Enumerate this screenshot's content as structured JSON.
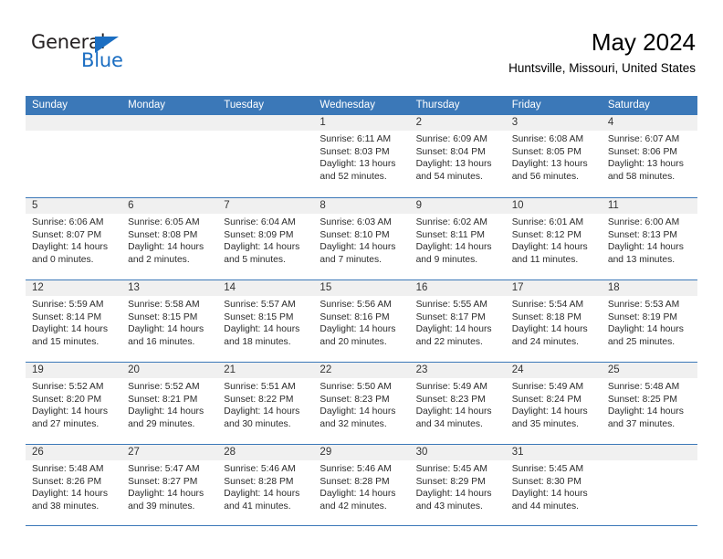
{
  "logo": {
    "word1": "General",
    "word2": "Blue",
    "triangle_color": "#1b6ec2"
  },
  "header": {
    "title": "May 2024",
    "subtitle": "Huntsville, Missouri, United States"
  },
  "theme": {
    "header_blue": "#3b78b8",
    "day_band_gray": "#f0f0f0",
    "text_color": "#2b2b2b"
  },
  "weekdays": [
    "Sunday",
    "Monday",
    "Tuesday",
    "Wednesday",
    "Thursday",
    "Friday",
    "Saturday"
  ],
  "labels": {
    "sunrise": "Sunrise:",
    "sunset": "Sunset:",
    "daylight": "Daylight:"
  },
  "weeks": [
    [
      {
        "day": "",
        "empty": true
      },
      {
        "day": "",
        "empty": true
      },
      {
        "day": "",
        "empty": true
      },
      {
        "day": "1",
        "sunrise": "Sunrise: 6:11 AM",
        "sunset": "Sunset: 8:03 PM",
        "daylight": "Daylight: 13 hours and 52 minutes."
      },
      {
        "day": "2",
        "sunrise": "Sunrise: 6:09 AM",
        "sunset": "Sunset: 8:04 PM",
        "daylight": "Daylight: 13 hours and 54 minutes."
      },
      {
        "day": "3",
        "sunrise": "Sunrise: 6:08 AM",
        "sunset": "Sunset: 8:05 PM",
        "daylight": "Daylight: 13 hours and 56 minutes."
      },
      {
        "day": "4",
        "sunrise": "Sunrise: 6:07 AM",
        "sunset": "Sunset: 8:06 PM",
        "daylight": "Daylight: 13 hours and 58 minutes."
      }
    ],
    [
      {
        "day": "5",
        "sunrise": "Sunrise: 6:06 AM",
        "sunset": "Sunset: 8:07 PM",
        "daylight": "Daylight: 14 hours and 0 minutes."
      },
      {
        "day": "6",
        "sunrise": "Sunrise: 6:05 AM",
        "sunset": "Sunset: 8:08 PM",
        "daylight": "Daylight: 14 hours and 2 minutes."
      },
      {
        "day": "7",
        "sunrise": "Sunrise: 6:04 AM",
        "sunset": "Sunset: 8:09 PM",
        "daylight": "Daylight: 14 hours and 5 minutes."
      },
      {
        "day": "8",
        "sunrise": "Sunrise: 6:03 AM",
        "sunset": "Sunset: 8:10 PM",
        "daylight": "Daylight: 14 hours and 7 minutes."
      },
      {
        "day": "9",
        "sunrise": "Sunrise: 6:02 AM",
        "sunset": "Sunset: 8:11 PM",
        "daylight": "Daylight: 14 hours and 9 minutes."
      },
      {
        "day": "10",
        "sunrise": "Sunrise: 6:01 AM",
        "sunset": "Sunset: 8:12 PM",
        "daylight": "Daylight: 14 hours and 11 minutes."
      },
      {
        "day": "11",
        "sunrise": "Sunrise: 6:00 AM",
        "sunset": "Sunset: 8:13 PM",
        "daylight": "Daylight: 14 hours and 13 minutes."
      }
    ],
    [
      {
        "day": "12",
        "sunrise": "Sunrise: 5:59 AM",
        "sunset": "Sunset: 8:14 PM",
        "daylight": "Daylight: 14 hours and 15 minutes."
      },
      {
        "day": "13",
        "sunrise": "Sunrise: 5:58 AM",
        "sunset": "Sunset: 8:15 PM",
        "daylight": "Daylight: 14 hours and 16 minutes."
      },
      {
        "day": "14",
        "sunrise": "Sunrise: 5:57 AM",
        "sunset": "Sunset: 8:15 PM",
        "daylight": "Daylight: 14 hours and 18 minutes."
      },
      {
        "day": "15",
        "sunrise": "Sunrise: 5:56 AM",
        "sunset": "Sunset: 8:16 PM",
        "daylight": "Daylight: 14 hours and 20 minutes."
      },
      {
        "day": "16",
        "sunrise": "Sunrise: 5:55 AM",
        "sunset": "Sunset: 8:17 PM",
        "daylight": "Daylight: 14 hours and 22 minutes."
      },
      {
        "day": "17",
        "sunrise": "Sunrise: 5:54 AM",
        "sunset": "Sunset: 8:18 PM",
        "daylight": "Daylight: 14 hours and 24 minutes."
      },
      {
        "day": "18",
        "sunrise": "Sunrise: 5:53 AM",
        "sunset": "Sunset: 8:19 PM",
        "daylight": "Daylight: 14 hours and 25 minutes."
      }
    ],
    [
      {
        "day": "19",
        "sunrise": "Sunrise: 5:52 AM",
        "sunset": "Sunset: 8:20 PM",
        "daylight": "Daylight: 14 hours and 27 minutes."
      },
      {
        "day": "20",
        "sunrise": "Sunrise: 5:52 AM",
        "sunset": "Sunset: 8:21 PM",
        "daylight": "Daylight: 14 hours and 29 minutes."
      },
      {
        "day": "21",
        "sunrise": "Sunrise: 5:51 AM",
        "sunset": "Sunset: 8:22 PM",
        "daylight": "Daylight: 14 hours and 30 minutes."
      },
      {
        "day": "22",
        "sunrise": "Sunrise: 5:50 AM",
        "sunset": "Sunset: 8:23 PM",
        "daylight": "Daylight: 14 hours and 32 minutes."
      },
      {
        "day": "23",
        "sunrise": "Sunrise: 5:49 AM",
        "sunset": "Sunset: 8:23 PM",
        "daylight": "Daylight: 14 hours and 34 minutes."
      },
      {
        "day": "24",
        "sunrise": "Sunrise: 5:49 AM",
        "sunset": "Sunset: 8:24 PM",
        "daylight": "Daylight: 14 hours and 35 minutes."
      },
      {
        "day": "25",
        "sunrise": "Sunrise: 5:48 AM",
        "sunset": "Sunset: 8:25 PM",
        "daylight": "Daylight: 14 hours and 37 minutes."
      }
    ],
    [
      {
        "day": "26",
        "sunrise": "Sunrise: 5:48 AM",
        "sunset": "Sunset: 8:26 PM",
        "daylight": "Daylight: 14 hours and 38 minutes."
      },
      {
        "day": "27",
        "sunrise": "Sunrise: 5:47 AM",
        "sunset": "Sunset: 8:27 PM",
        "daylight": "Daylight: 14 hours and 39 minutes."
      },
      {
        "day": "28",
        "sunrise": "Sunrise: 5:46 AM",
        "sunset": "Sunset: 8:28 PM",
        "daylight": "Daylight: 14 hours and 41 minutes."
      },
      {
        "day": "29",
        "sunrise": "Sunrise: 5:46 AM",
        "sunset": "Sunset: 8:28 PM",
        "daylight": "Daylight: 14 hours and 42 minutes."
      },
      {
        "day": "30",
        "sunrise": "Sunrise: 5:45 AM",
        "sunset": "Sunset: 8:29 PM",
        "daylight": "Daylight: 14 hours and 43 minutes."
      },
      {
        "day": "31",
        "sunrise": "Sunrise: 5:45 AM",
        "sunset": "Sunset: 8:30 PM",
        "daylight": "Daylight: 14 hours and 44 minutes."
      },
      {
        "day": "",
        "empty": true
      }
    ]
  ]
}
